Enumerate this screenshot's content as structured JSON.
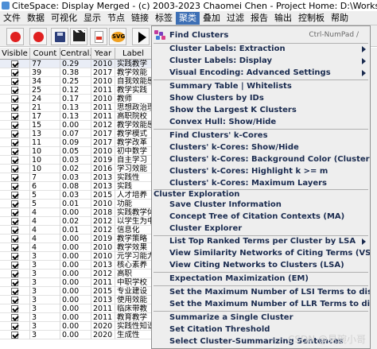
{
  "window": {
    "title": "CiteSpace: Display Merged - (c) 2003-2023 Chaomei Chen - Project Home: D:\\Workspace\\CiteSpaceProjects\\DemoCNKI\\pro"
  },
  "menubar": [
    "文件",
    "数据",
    "可视化",
    "显示",
    "节点",
    "链接",
    "标签",
    "聚类",
    "叠加",
    "过滤",
    "报告",
    "输出",
    "控制板",
    "帮助"
  ],
  "menubar_active_index": 7,
  "toolbar": {
    "icons": [
      "red-circle-icon",
      "red-circle-icon",
      "save-icon",
      "clapperboard-icon",
      "pdf-icon",
      "svg-icon",
      "play-icon"
    ]
  },
  "table": {
    "columns": [
      "Visible",
      "Count",
      "Central...",
      "Year",
      "Label"
    ],
    "rows": [
      [
        "77",
        "0.29",
        "2010",
        "实践教学"
      ],
      [
        "39",
        "0.38",
        "2017",
        "教学效能"
      ],
      [
        "34",
        "0.25",
        "2010",
        "自我效能感"
      ],
      [
        "25",
        "0.12",
        "2011",
        "教学实践"
      ],
      [
        "24",
        "0.17",
        "2010",
        "教师"
      ],
      [
        "21",
        "0.13",
        "2011",
        "思想政治理"
      ],
      [
        "17",
        "0.13",
        "2011",
        "高职院校"
      ],
      [
        "15",
        "0.00",
        "2012",
        "教学效能感"
      ],
      [
        "13",
        "0.07",
        "2017",
        "教学模式"
      ],
      [
        "11",
        "0.09",
        "2017",
        "教学改革"
      ],
      [
        "10",
        "0.05",
        "2010",
        "初中数学"
      ],
      [
        "10",
        "0.03",
        "2019",
        "自主学习"
      ],
      [
        "10",
        "0.02",
        "2016",
        "学习效能"
      ],
      [
        "7",
        "0.03",
        "2013",
        "实践性"
      ],
      [
        "6",
        "0.08",
        "2013",
        "实践"
      ],
      [
        "5",
        "0.03",
        "2015",
        "人才培养"
      ],
      [
        "5",
        "0.01",
        "2010",
        "功能"
      ],
      [
        "4",
        "0.00",
        "2018",
        "实践教学体"
      ],
      [
        "4",
        "0.02",
        "2012",
        "以学生为中"
      ],
      [
        "4",
        "0.01",
        "2012",
        "信息化"
      ],
      [
        "4",
        "0.00",
        "2019",
        "教学策略"
      ],
      [
        "4",
        "0.00",
        "2010",
        "教学效果"
      ],
      [
        "3",
        "0.00",
        "2010",
        "元学习能力"
      ],
      [
        "3",
        "0.00",
        "2013",
        "核心素养"
      ],
      [
        "3",
        "0.00",
        "2012",
        "高职"
      ],
      [
        "3",
        "0.00",
        "2011",
        "中职学校"
      ],
      [
        "3",
        "0.00",
        "2015",
        "专业建设"
      ],
      [
        "3",
        "0.00",
        "2013",
        "使用效能"
      ],
      [
        "3",
        "0.00",
        "2011",
        "临床带教"
      ],
      [
        "3",
        "0.00",
        "2011",
        "教育教学"
      ],
      [
        "3",
        "0.00",
        "2020",
        "实践性知识"
      ],
      [
        "3",
        "0.00",
        "2020",
        "生成性"
      ]
    ]
  },
  "cluster_menu": {
    "find_clusters": {
      "label": "Find Clusters",
      "accelerator": "Ctrl-NumPad /"
    },
    "items_group1": [
      {
        "label": "Cluster Labels: Extraction",
        "submenu": true
      },
      {
        "label": "Cluster Labels: Display",
        "submenu": true
      },
      {
        "label": "Visual Encoding: Advanced Settings",
        "submenu": true
      }
    ],
    "items_group2": [
      {
        "label": "Summary Table | Whitelists"
      },
      {
        "label": "Show Clusters by IDs"
      },
      {
        "label": "Show the Largest K Clusters"
      },
      {
        "label": "Convex Hull: Show/Hide"
      }
    ],
    "items_group3": [
      {
        "label": "Find Clusters' k-Cores"
      },
      {
        "label": "Clusters' k-Cores: Show/Hide"
      },
      {
        "label": "Clusters' k-Cores: Background Color (Cluster)"
      },
      {
        "label": "Clusters' k-Cores: Highlight k >= m"
      },
      {
        "label": "Clusters' k-Cores: Maximum Layers"
      }
    ],
    "exploration_header": "Cluster Exploration",
    "items_group4": [
      {
        "label": "Save Cluster Information"
      },
      {
        "label": "Concept Tree of Citation Contexts (MA)"
      },
      {
        "label": "Cluster Explorer"
      }
    ],
    "items_group5": [
      {
        "label": "List Top Ranked Terms per Cluster by LSA",
        "submenu": true
      },
      {
        "label": "View Similarity Networks of Citing Terms (VSM)"
      },
      {
        "label": "View Citing Networks to Clusters (LSA)"
      }
    ],
    "items_group6": [
      {
        "label": "Expectation Maximization (EM)"
      }
    ],
    "items_group7": [
      {
        "label": "Set the Maximum Number of LSI Terms to display"
      },
      {
        "label": "Set the Maximum Number of LLR Terms to display"
      }
    ],
    "items_group8": [
      {
        "label": "Summarize a Single Cluster"
      },
      {
        "label": "Set Citation Threshold"
      },
      {
        "label": "Select Cluster-Summarizing Sentences"
      }
    ]
  },
  "watermark": "CSDN @易碗小哥"
}
